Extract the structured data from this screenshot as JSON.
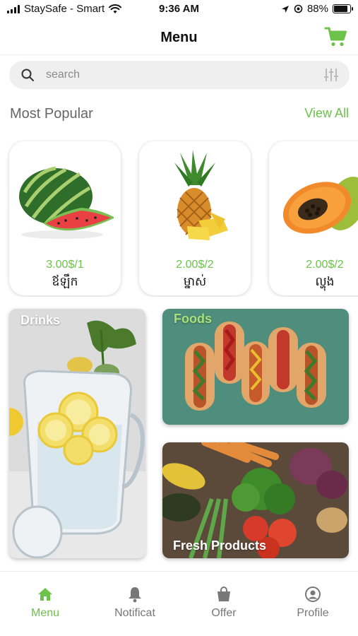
{
  "status_bar": {
    "carrier": "StaySafe - Smart",
    "time": "9:36 AM",
    "battery_percent": "88%",
    "battery_level": 0.88,
    "icons": [
      "signal-icon",
      "wifi-icon",
      "location-icon",
      "alarm-icon",
      "battery-icon"
    ]
  },
  "header": {
    "title": "Menu",
    "cart_icon": "cart-icon"
  },
  "search": {
    "placeholder": "search",
    "value": "",
    "icon": "search-icon",
    "filter_icon": "filter-icon"
  },
  "popular": {
    "title": "Most Popular",
    "view_all": "View All",
    "items": [
      {
        "price": "3.00$/1",
        "name": "ឪឡឹក",
        "image": "watermelon"
      },
      {
        "price": "2.00$/2",
        "name": "ម្នាស់",
        "image": "pineapple"
      },
      {
        "price": "2.00$/2",
        "name": "ល្ហុង",
        "image": "papaya"
      }
    ]
  },
  "categories": [
    {
      "label": "Drinks",
      "image": "lemon-water-jug"
    },
    {
      "label": "Foods",
      "image": "hot-dogs"
    },
    {
      "label": "Fresh Products",
      "image": "vegetables"
    }
  ],
  "tabs": [
    {
      "label": "Menu",
      "icon": "home-icon",
      "active": true
    },
    {
      "label": "Notificat",
      "icon": "bell-icon",
      "active": false
    },
    {
      "label": "Offer",
      "icon": "shopping-bag-icon",
      "active": false
    },
    {
      "label": "Profile",
      "icon": "profile-icon",
      "active": false
    }
  ],
  "colors": {
    "accent": "#6cc24a",
    "search_bg": "#efefef",
    "muted_text": "#777777"
  }
}
